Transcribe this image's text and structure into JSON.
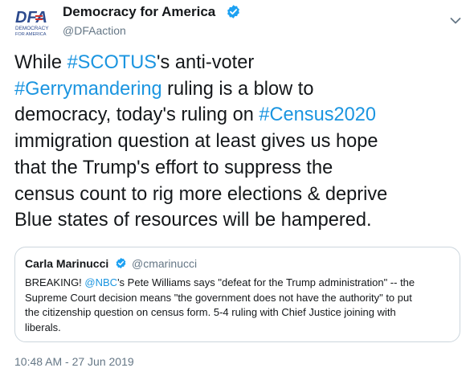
{
  "author": {
    "display_name": "Democracy for America",
    "handle": "@DFAaction",
    "verified": true,
    "avatar_logo": "DFA",
    "avatar_subtitle": [
      "DEMOCRACY",
      "FOR AMERICA"
    ]
  },
  "tweet": {
    "lines": [
      [
        {
          "t": "While ",
          "h": false
        },
        {
          "t": "#SCOTUS",
          "h": true
        },
        {
          "t": "'s anti-voter",
          "h": false
        }
      ],
      [
        {
          "t": "#Gerrymandering",
          "h": true
        },
        {
          "t": " ruling is a blow to",
          "h": false
        }
      ],
      [
        {
          "t": "democracy, today's ruling on ",
          "h": false
        },
        {
          "t": "#Census2020",
          "h": true
        }
      ],
      [
        {
          "t": "immigration question at least gives us hope",
          "h": false
        }
      ],
      [
        {
          "t": "that the Trump's effort to suppress the",
          "h": false
        }
      ],
      [
        {
          "t": "census count to rig more elections & deprive",
          "h": false
        }
      ],
      [
        {
          "t": "Blue states of resources will be hampered.",
          "h": false
        }
      ]
    ],
    "timestamp": "10:48 AM - 27 Jun 2019"
  },
  "quoted_tweet": {
    "display_name": "Carla Marinucci",
    "handle": "@cmarinucci",
    "verified": true,
    "lines": [
      [
        {
          "t": "BREAKING! ",
          "h": false
        },
        {
          "t": "@NBC",
          "h": true
        },
        {
          "t": "'s Pete Williams says \"defeat for the Trump administration\" -- the",
          "h": false
        }
      ],
      [
        {
          "t": "Supreme Court decision means \"the government does not have the authority\" to put",
          "h": false
        }
      ],
      [
        {
          "t": "the citizenship question on census form. 5-4 ruling with Chief Justice joining with",
          "h": false
        }
      ],
      [
        {
          "t": "liberals.",
          "h": false
        }
      ]
    ]
  },
  "icons": {
    "verified": "verified-badge-icon",
    "menu": "chevron-down-icon"
  },
  "colors": {
    "link": "#1b95e0",
    "text": "#14171a",
    "secondary": "#657786",
    "verified": "#1da1f2",
    "logo_blue": "#2d4b8e",
    "logo_red": "#d0312d",
    "border": "#ccd6dd"
  }
}
